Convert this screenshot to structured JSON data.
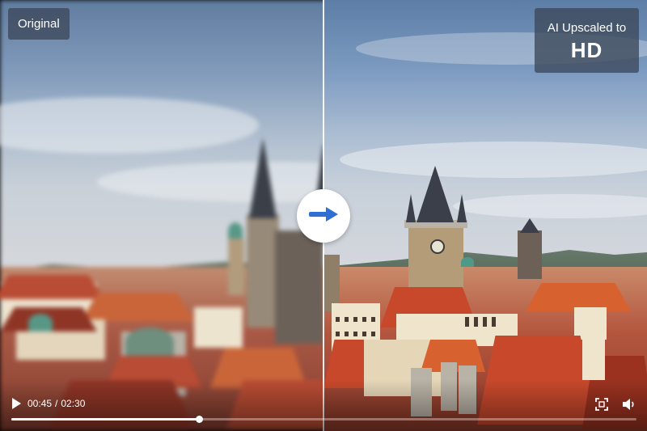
{
  "labels": {
    "original": "Original",
    "upscaled_line1": "AI Upscaled to",
    "upscaled_line2": "HD"
  },
  "compare_handle": {
    "icon": "arrow-right-icon",
    "accent_color": "#2f6fd3"
  },
  "player": {
    "current_time": "00:45",
    "separator": "/",
    "duration": "02:30",
    "progress_fraction": 0.3,
    "play_icon": "play-icon",
    "fullscreen_icon": "fullscreen-icon",
    "volume_icon": "volume-icon"
  }
}
